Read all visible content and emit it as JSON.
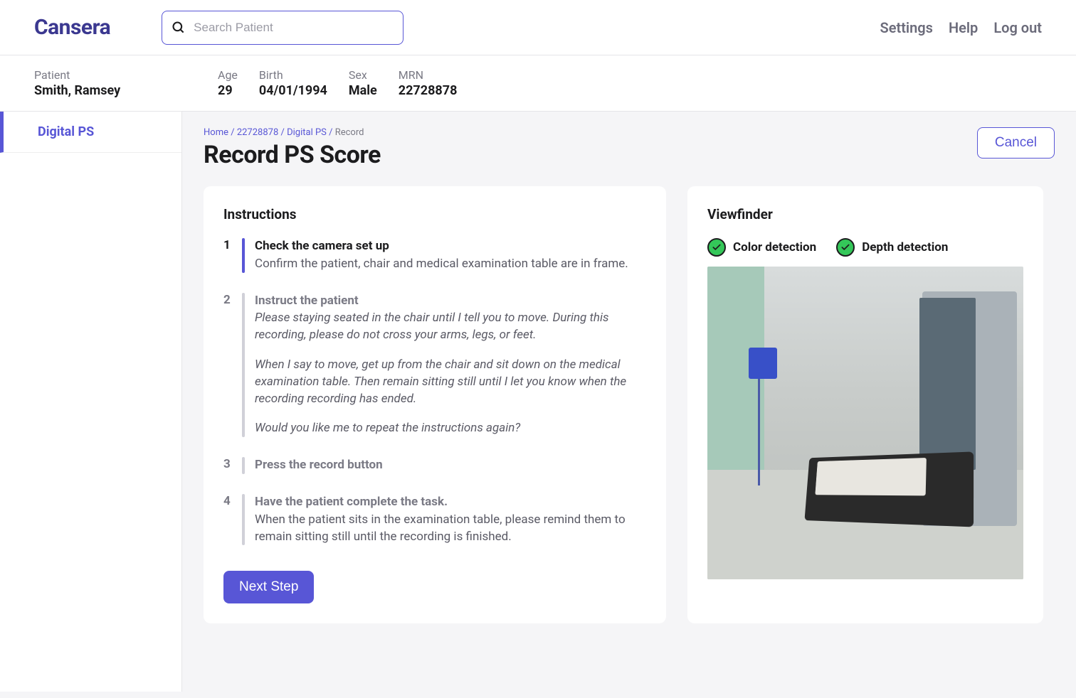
{
  "brand": "Cansera",
  "search": {
    "placeholder": "Search Patient"
  },
  "header_links": {
    "settings": "Settings",
    "help": "Help",
    "logout": "Log out"
  },
  "patient": {
    "name_label": "Patient",
    "name": "Smith, Ramsey",
    "age_label": "Age",
    "age": "29",
    "birth_label": "Birth",
    "birth": "04/01/1994",
    "sex_label": "Sex",
    "sex": "Male",
    "mrn_label": "MRN",
    "mrn": "22728878"
  },
  "sidebar": {
    "digital_ps": "Digital PS"
  },
  "breadcrumb": {
    "home": "Home",
    "mrn": "22728878",
    "section": "Digital PS",
    "current": "Record",
    "sep": " / "
  },
  "page_title": "Record PS Score",
  "cancel_label": "Cancel",
  "instructions": {
    "title": "Instructions",
    "steps": [
      {
        "num": "1",
        "title": "Check the camera set up",
        "desc": "Confirm the patient, chair and medical examination table are in frame."
      },
      {
        "num": "2",
        "title": "Instruct the patient",
        "p1": "Please staying seated in the chair until I tell you to move. During this recording, please do not cross your arms, legs, or feet.",
        "p2": "When I say to move, get up from the chair and sit down on the medical examination table. Then remain sitting still until I let you know when the recording recording has ended.",
        "p3": "Would you like me to repeat the instructions again?"
      },
      {
        "num": "3",
        "title": "Press the record button"
      },
      {
        "num": "4",
        "title": "Have the patient complete the task.",
        "desc": "When the patient sits in the examination table, please remind them to remain sitting still until the recording is finished."
      }
    ],
    "next_label": "Next Step"
  },
  "viewfinder": {
    "title": "Viewfinder",
    "color_detection": "Color detection",
    "depth_detection": "Depth detection"
  }
}
